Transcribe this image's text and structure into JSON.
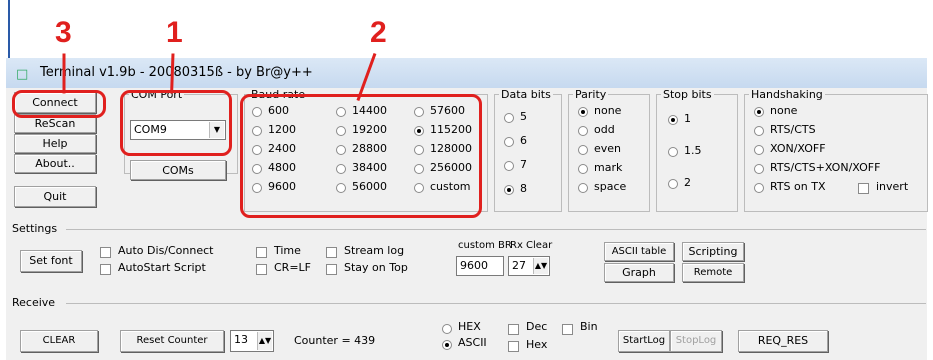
{
  "window": {
    "title": "Terminal v1.9b - 20080315ß - by Br@y++"
  },
  "annotations": {
    "num1": "1",
    "num2": "2",
    "num3": "3"
  },
  "left_buttons": {
    "connect": "Connect",
    "rescan": "ReScan",
    "help": "Help",
    "about": "About..",
    "quit": "Quit"
  },
  "com_port": {
    "legend": "COM Port",
    "value": "COM9",
    "coms_button": "COMs"
  },
  "baud_rate": {
    "legend": "Baud rate",
    "options": [
      "600",
      "1200",
      "2400",
      "4800",
      "9600",
      "14400",
      "19200",
      "28800",
      "38400",
      "56000",
      "57600",
      "115200",
      "128000",
      "256000",
      "custom"
    ],
    "selected": "115200"
  },
  "data_bits": {
    "legend": "Data bits",
    "options": [
      "5",
      "6",
      "7",
      "8"
    ],
    "selected": "8"
  },
  "parity": {
    "legend": "Parity",
    "options": [
      "none",
      "odd",
      "even",
      "mark",
      "space"
    ],
    "selected": "none"
  },
  "stop_bits": {
    "legend": "Stop bits",
    "options": [
      "1",
      "1.5",
      "2"
    ],
    "selected": "1"
  },
  "handshaking": {
    "legend": "Handshaking",
    "options": [
      "none",
      "RTS/CTS",
      "XON/XOFF",
      "RTS/CTS+XON/XOFF",
      "RTS on TX"
    ],
    "selected": "none",
    "invert": "invert"
  },
  "settings": {
    "legend": "Settings",
    "set_font": "Set font",
    "auto_dis_connect": "Auto Dis/Connect",
    "autostart_script": "AutoStart Script",
    "time": "Time",
    "cr_lf": "CR=LF",
    "stream_log": "Stream log",
    "stay_on_top": "Stay on Top",
    "custom_br_label": "custom BR",
    "custom_br_value": "9600",
    "rx_clear_label": "Rx Clear",
    "rx_clear_value": "27",
    "ascii_table": "ASCII table",
    "scripting": "Scripting",
    "graph": "Graph",
    "remote": "Remote"
  },
  "receive": {
    "legend": "Receive",
    "clear": "CLEAR",
    "reset_counter": "Reset Counter",
    "counter_spin": "13",
    "counter_label": "Counter = 439",
    "hex": "HEX",
    "ascii": "ASCII",
    "selected": "ASCII",
    "dec": "Dec",
    "bin": "Bin",
    "hex_check": "Hex",
    "start_log": "StartLog",
    "stop_log": "StopLog",
    "req_res": "REQ_RES"
  },
  "colors": {
    "annotation": "#e0201e",
    "window_bg": "#f0f0f0"
  }
}
